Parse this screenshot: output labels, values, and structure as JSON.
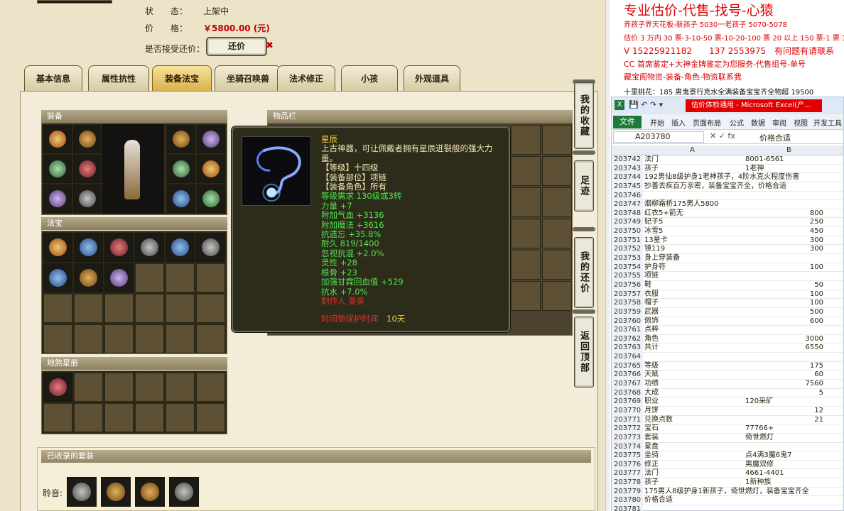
{
  "listing": {
    "status_label": "状　　态：",
    "status_value": "上架中",
    "price_label": "价　　格：",
    "price_value": "￥5800.00 (元)",
    "accept_label": "是否接受还价：",
    "bargain_button": "还价"
  },
  "tabs": [
    "基本信息",
    "属性抗性",
    "装备法宝",
    "坐骑召唤兽",
    "法术修正",
    "小孩",
    "外观道具"
  ],
  "active_tab": "装备法宝",
  "sections": {
    "equipment": "装备",
    "treasure": "法宝",
    "artifact": "地煞星册",
    "inventory": "物品栏",
    "collected_sets": "已收录的套装",
    "set_row_label": "聆音:"
  },
  "tooltip": {
    "name": "星辰",
    "lines": [
      {
        "text": "上古神器，可让佩戴者拥有星辰迸裂般的强大力",
        "color": "w"
      },
      {
        "text": "量。",
        "color": "w"
      },
      {
        "text": "【等级】十四级",
        "color": "w"
      },
      {
        "text": "【装备部位】项链",
        "color": "w"
      },
      {
        "text": "【装备角色】所有",
        "color": "w"
      },
      {
        "text": "等级需求 130级或3转",
        "color": "g"
      },
      {
        "text": "力量 +7",
        "color": "g"
      },
      {
        "text": "附加气血 +3136",
        "color": "g"
      },
      {
        "text": "附加魔法 +3616",
        "color": "g"
      },
      {
        "text": "抗遗忘 +35.8%",
        "color": "g"
      },
      {
        "text": "耐久 819/1400",
        "color": "g"
      },
      {
        "text": "忽视抗混 +2.0%",
        "color": "g"
      },
      {
        "text": "灵性 +28",
        "color": "g"
      },
      {
        "text": "根骨 +23",
        "color": "g"
      },
      {
        "text": "加强甘霖回血值 +529",
        "color": "g"
      },
      {
        "text": "抗水 +7.0%",
        "color": "g"
      },
      {
        "text": "制作人 昊昊",
        "color": "r"
      }
    ],
    "protect_label": "时间锁保护时间",
    "protect_value": "10天"
  },
  "side_buttons": [
    "我的收藏",
    "足迹",
    "我的还价",
    "返回顶部"
  ],
  "notes": {
    "headline": "专业估价-代售-找号-心猿",
    "line2": "养孩子界天花板-新孩子 5030一老孩子 5070-5078",
    "line3": "估价 3 万内 30 票-3-10-50 票-10-20-100 票 20 以上 150 票-1 票 1",
    "line4": "V 15225921182　　137 2553975　有问题有请联系",
    "line5": "CC 首席鉴定+大神金牌鉴定为您服务-代售组号-单号",
    "line6": "藏宝阁物资-装备-角色-物资联系我",
    "line7": "十里桃花：185 男鬼景行克水全满装备宝宝齐全物超 19500"
  },
  "excel": {
    "window_title": "估价体检通用 - Microsoft Excel(产...",
    "file_tab": "文件",
    "ribbon_tabs": [
      "开始",
      "插入",
      "页面布局",
      "公式",
      "数据",
      "审阅",
      "视图",
      "开发工具"
    ],
    "name_box": "A203780",
    "formula_value": "价格合适",
    "col_a": "A",
    "col_b": "B",
    "rows": [
      {
        "n": "203742",
        "a": "法门",
        "b": "8001-6561",
        "t": "l"
      },
      {
        "n": "203743",
        "a": "孩子",
        "b": "1老神",
        "t": "l"
      },
      {
        "n": "203744",
        "a": "192男仙8级护身1老神孩子，4阶水克火程度伤害",
        "b": "",
        "t": "l"
      },
      {
        "n": "203745",
        "a": "抄善去疾百万亲密，装备宝宝齐全，价格合适",
        "b": "",
        "t": "l"
      },
      {
        "n": "203746",
        "a": "",
        "b": "",
        "t": "l"
      },
      {
        "n": "203747",
        "a": "烟柳霜桥175男人5800",
        "b": "",
        "t": "l"
      },
      {
        "n": "203748",
        "a": "红衣5+箭无",
        "b": "800",
        "t": "r"
      },
      {
        "n": "203749",
        "a": "妃子5",
        "b": "250",
        "t": "r"
      },
      {
        "n": "203750",
        "a": "冰雪5",
        "b": "450",
        "t": "r"
      },
      {
        "n": "203751",
        "a": "13星卡",
        "b": "300",
        "t": "r"
      },
      {
        "n": "203752",
        "a": "镜119",
        "b": "300",
        "t": "r"
      },
      {
        "n": "203753",
        "a": "身上穿装备",
        "b": "",
        "t": "r"
      },
      {
        "n": "203754",
        "a": "护身符",
        "b": "100",
        "t": "r"
      },
      {
        "n": "203755",
        "a": "项链",
        "b": "",
        "t": "r"
      },
      {
        "n": "203756",
        "a": "鞋",
        "b": "50",
        "t": "r"
      },
      {
        "n": "203757",
        "a": "衣服",
        "b": "100",
        "t": "r"
      },
      {
        "n": "203758",
        "a": "帽子",
        "b": "100",
        "t": "r"
      },
      {
        "n": "203759",
        "a": "武器",
        "b": "500",
        "t": "r"
      },
      {
        "n": "203760",
        "a": "佩饰",
        "b": "600",
        "t": "r"
      },
      {
        "n": "203761",
        "a": "点粹",
        "b": "",
        "t": "r"
      },
      {
        "n": "203762",
        "a": "角色",
        "b": "3000",
        "t": "r"
      },
      {
        "n": "203763",
        "a": "共计",
        "b": "6550",
        "t": "r"
      },
      {
        "n": "203764",
        "a": "",
        "b": "",
        "t": "r"
      },
      {
        "n": "203765",
        "a": "等级",
        "b": "175",
        "t": "r"
      },
      {
        "n": "203766",
        "a": "天赋",
        "b": "60",
        "t": "r"
      },
      {
        "n": "203767",
        "a": "功绩",
        "b": "7560",
        "t": "r"
      },
      {
        "n": "203768",
        "a": "大成",
        "b": "5",
        "t": "r"
      },
      {
        "n": "203769",
        "a": "职业",
        "b": "120采矿",
        "t": "l"
      },
      {
        "n": "203770",
        "a": "月饼",
        "b": "12",
        "t": "r"
      },
      {
        "n": "203771",
        "a": "兑换点数",
        "b": "21",
        "t": "r"
      },
      {
        "n": "203772",
        "a": "宝石",
        "b": "77766+",
        "t": "l"
      },
      {
        "n": "203773",
        "a": "套装",
        "b": "倚世燃灯",
        "t": "l"
      },
      {
        "n": "203774",
        "a": "星盘",
        "b": "",
        "t": "l"
      },
      {
        "n": "203775",
        "a": "坐骑",
        "b": "点4满3魔6鬼7",
        "t": "l"
      },
      {
        "n": "203776",
        "a": "修正",
        "b": "男魔双修",
        "t": "l"
      },
      {
        "n": "203777",
        "a": "法门",
        "b": "4661-4401",
        "t": "l"
      },
      {
        "n": "203778",
        "a": "孩子",
        "b": "1新种族",
        "t": "l"
      },
      {
        "n": "203779",
        "a": "175男人8级护身1新孩子，倚世燃灯，装备宝宝齐全",
        "b": "",
        "t": "l"
      },
      {
        "n": "203780",
        "a": "价格合适",
        "b": "",
        "t": "l"
      },
      {
        "n": "203781",
        "a": "",
        "b": "",
        "t": "l"
      }
    ]
  },
  "colors": {
    "price_red": "#c40000",
    "tooltip_green": "#4ee84e",
    "tooltip_red": "#e03030",
    "tooltip_yellow": "#f5d142",
    "excel_green": "#1e7a3a",
    "headline_red": "#e00000"
  }
}
